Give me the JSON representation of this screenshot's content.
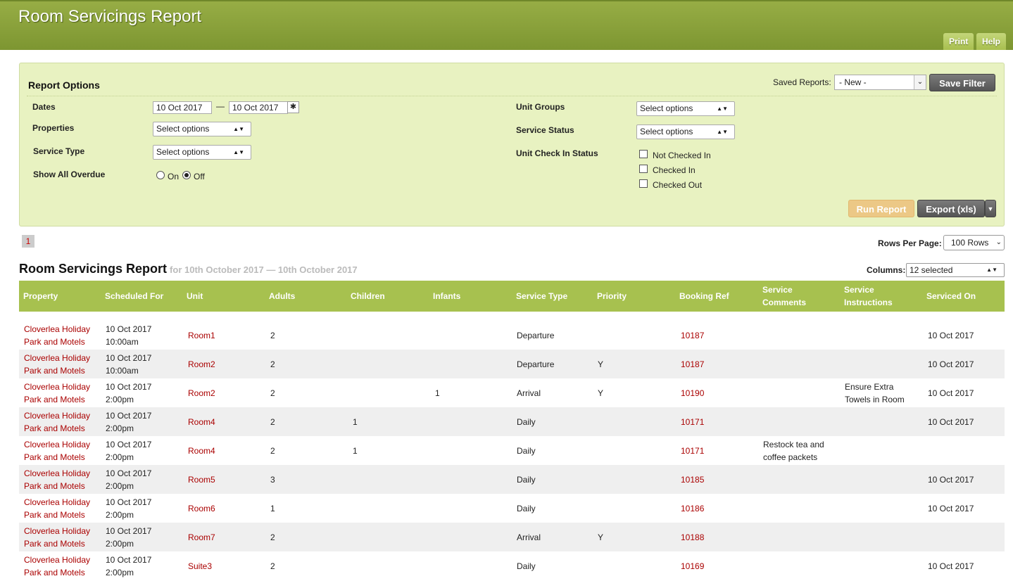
{
  "header": {
    "title": "Room Servicings Report",
    "print_label": "Print",
    "help_label": "Help"
  },
  "options": {
    "title": "Report Options",
    "saved_reports_label": "Saved Reports:",
    "saved_reports_value": "- New -",
    "save_filter_label": "Save Filter",
    "dates_label": "Dates",
    "date_from": "10 Oct 2017",
    "date_sep": "—",
    "date_to": "10 Oct 2017",
    "properties_label": "Properties",
    "properties_value": "Select options",
    "service_type_label": "Service Type",
    "service_type_value": "Select options",
    "show_overdue_label": "Show All Overdue",
    "on_label": "On",
    "off_label": "Off",
    "unit_groups_label": "Unit Groups",
    "unit_groups_value": "Select options",
    "service_status_label": "Service Status",
    "service_status_value": "Select options",
    "unit_checkin_label": "Unit Check In Status",
    "not_checked_in_label": "Not Checked In",
    "checked_in_label": "Checked In",
    "checked_out_label": "Checked Out",
    "run_report_label": "Run Report",
    "export_label": "Export (xls)"
  },
  "pagination": {
    "current_page": "1",
    "rows_per_page_label": "Rows Per Page:",
    "rows_per_page_value": "100 Rows"
  },
  "report": {
    "title": "Room Servicings Report",
    "subtitle": "for 10th October 2017 — 10th October 2017",
    "columns_label": "Columns:",
    "columns_value": "12 selected"
  },
  "table": {
    "headers": [
      "Property",
      "Scheduled For",
      "Unit",
      "Adults",
      "Children",
      "Infants",
      "Service Type",
      "Priority",
      "Booking Ref",
      "Service Comments",
      "Service Instructions",
      "Serviced On"
    ],
    "rows": [
      {
        "property": "Cloverlea Holiday Park and Motels",
        "scheduled": "10 Oct 2017 10:00am",
        "unit": "Room1",
        "adults": "2",
        "children": "",
        "infants": "",
        "service_type": "Departure",
        "priority": "",
        "booking_ref": "10187",
        "comments": "",
        "instructions": "",
        "serviced_on": "10 Oct 2017"
      },
      {
        "property": "Cloverlea Holiday Park and Motels",
        "scheduled": "10 Oct 2017 10:00am",
        "unit": "Room2",
        "adults": "2",
        "children": "",
        "infants": "",
        "service_type": "Departure",
        "priority": "Y",
        "booking_ref": "10187",
        "comments": "",
        "instructions": "",
        "serviced_on": "10 Oct 2017"
      },
      {
        "property": "Cloverlea Holiday Park and Motels",
        "scheduled": "10 Oct 2017 2:00pm",
        "unit": "Room2",
        "adults": "2",
        "children": "",
        "infants": "1",
        "service_type": "Arrival",
        "priority": "Y",
        "booking_ref": "10190",
        "comments": "",
        "instructions": "Ensure Extra Towels in Room",
        "serviced_on": "10 Oct 2017"
      },
      {
        "property": "Cloverlea Holiday Park and Motels",
        "scheduled": "10 Oct 2017 2:00pm",
        "unit": "Room4",
        "adults": "2",
        "children": "1",
        "infants": "",
        "service_type": "Daily",
        "priority": "",
        "booking_ref": "10171",
        "comments": "",
        "instructions": "",
        "serviced_on": "10 Oct 2017"
      },
      {
        "property": "Cloverlea Holiday Park and Motels",
        "scheduled": "10 Oct 2017 2:00pm",
        "unit": "Room4",
        "adults": "2",
        "children": "1",
        "infants": "",
        "service_type": "Daily",
        "priority": "",
        "booking_ref": "10171",
        "comments": "Restock tea and coffee packets",
        "instructions": "",
        "serviced_on": ""
      },
      {
        "property": "Cloverlea Holiday Park and Motels",
        "scheduled": "10 Oct 2017 2:00pm",
        "unit": "Room5",
        "adults": "3",
        "children": "",
        "infants": "",
        "service_type": "Daily",
        "priority": "",
        "booking_ref": "10185",
        "comments": "",
        "instructions": "",
        "serviced_on": "10 Oct 2017"
      },
      {
        "property": "Cloverlea Holiday Park and Motels",
        "scheduled": "10 Oct 2017 2:00pm",
        "unit": "Room6",
        "adults": "1",
        "children": "",
        "infants": "",
        "service_type": "Daily",
        "priority": "",
        "booking_ref": "10186",
        "comments": "",
        "instructions": "",
        "serviced_on": "10 Oct 2017"
      },
      {
        "property": "Cloverlea Holiday Park and Motels",
        "scheduled": "10 Oct 2017 2:00pm",
        "unit": "Room7",
        "adults": "2",
        "children": "",
        "infants": "",
        "service_type": "Arrival",
        "priority": "Y",
        "booking_ref": "10188",
        "comments": "",
        "instructions": "",
        "serviced_on": ""
      },
      {
        "property": "Cloverlea Holiday Park and Motels",
        "scheduled": "10 Oct 2017 2:00pm",
        "unit": "Suite3",
        "adults": "2",
        "children": "",
        "infants": "",
        "service_type": "Daily",
        "priority": "",
        "booking_ref": "10169",
        "comments": "",
        "instructions": "",
        "serviced_on": "10 Oct 2017"
      }
    ]
  }
}
